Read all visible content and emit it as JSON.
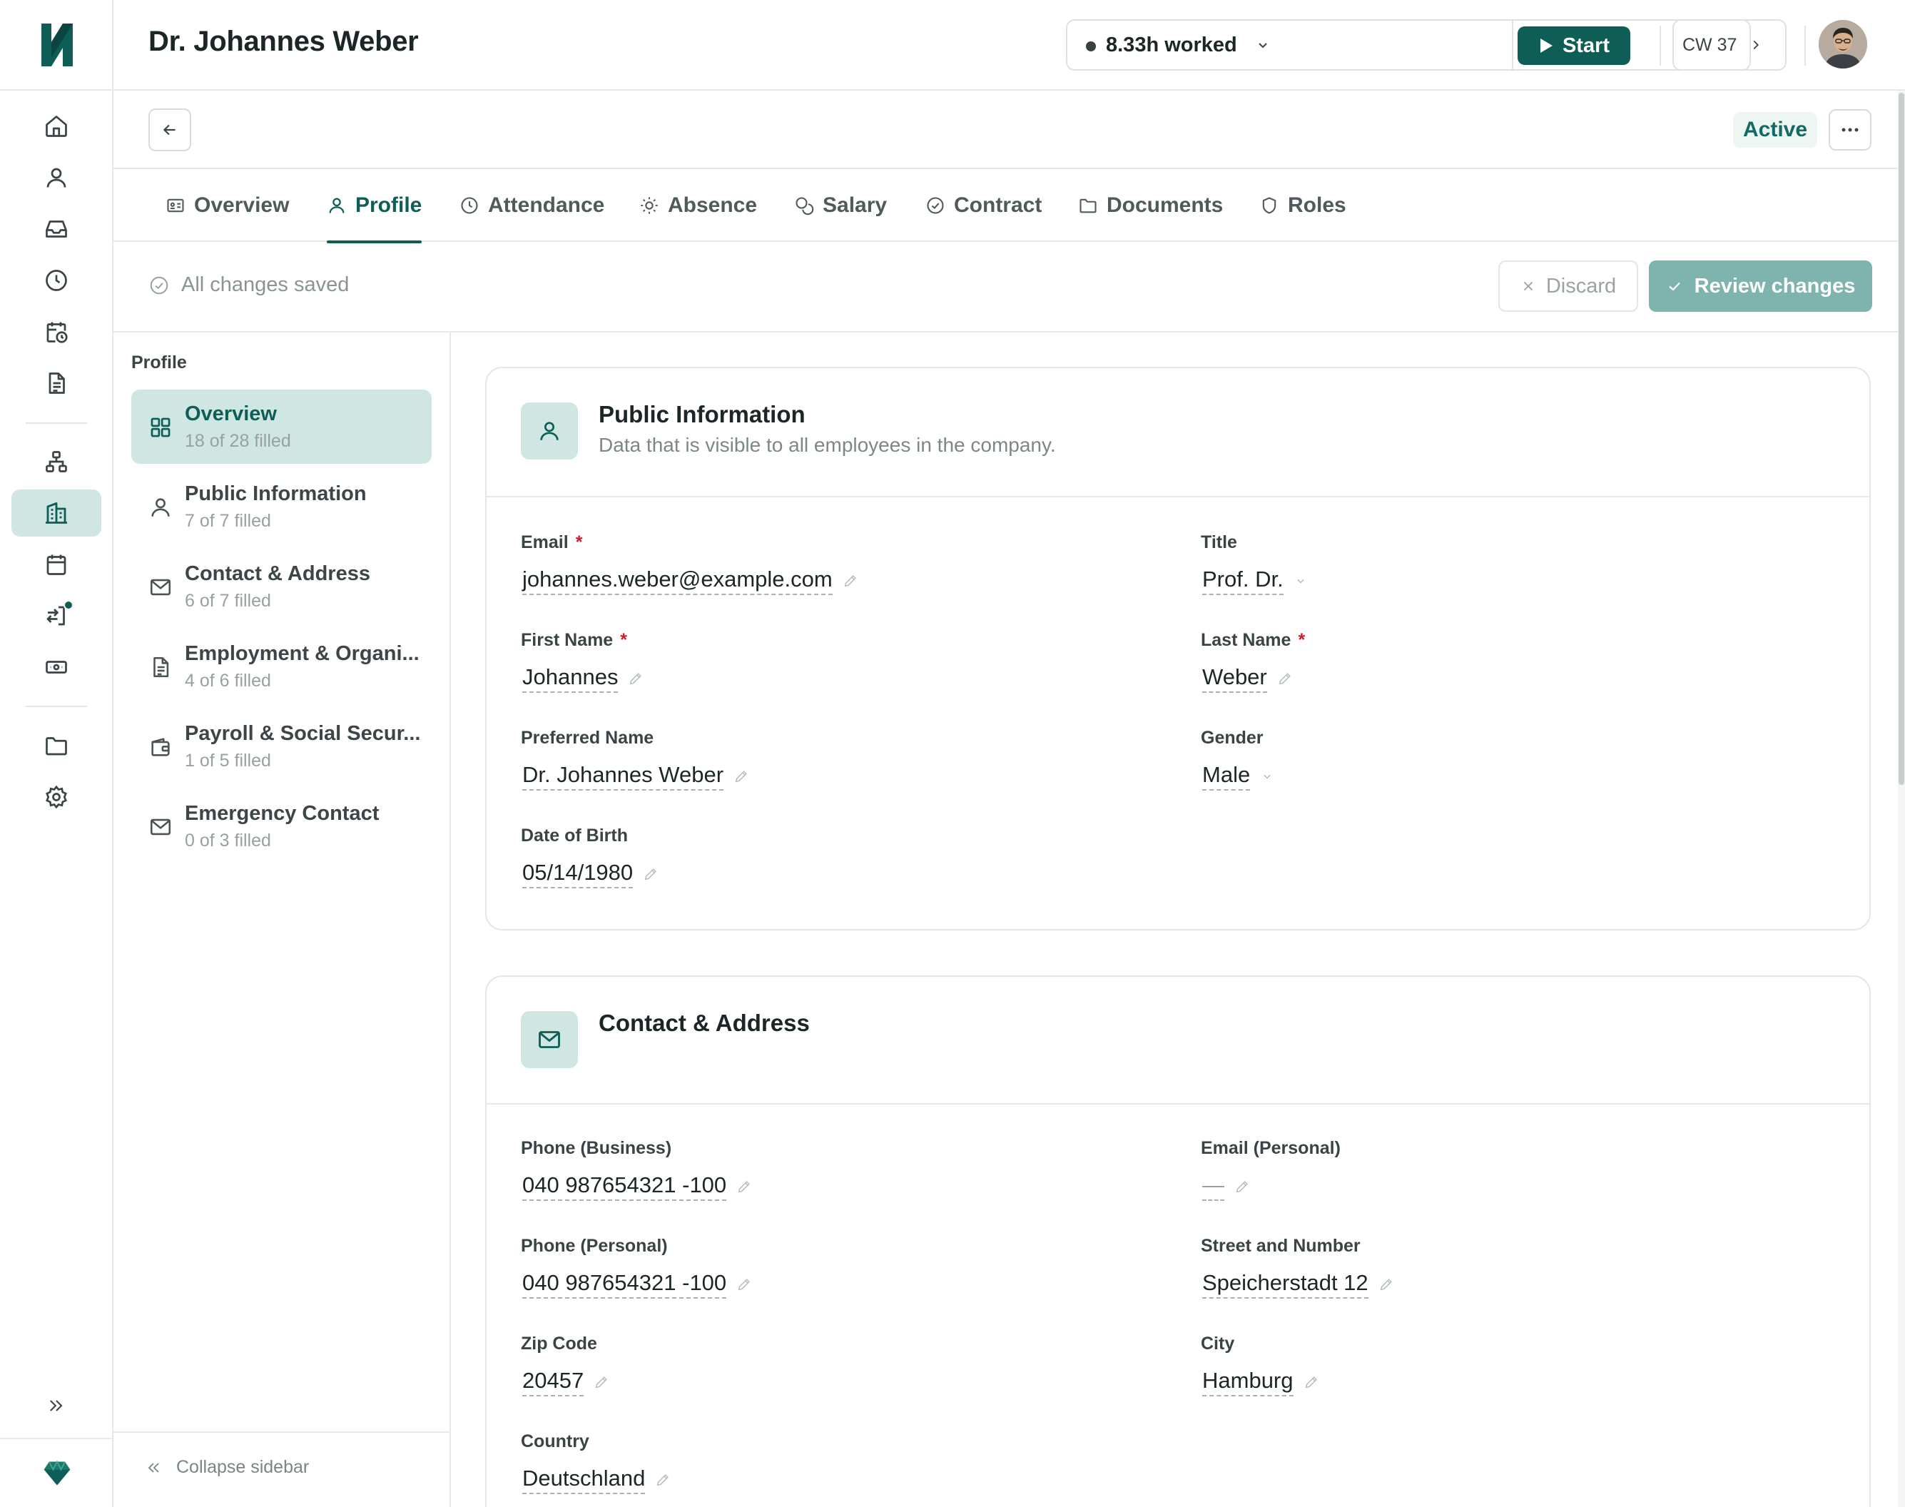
{
  "header": {
    "title": "Dr. Johannes Weber",
    "worked": "8.33h worked",
    "start_label": "Start",
    "week": "CW 37"
  },
  "subbar": {
    "status": "Active"
  },
  "tabs": [
    {
      "label": "Overview",
      "icon": "id-card-icon"
    },
    {
      "label": "Profile",
      "icon": "user-icon"
    },
    {
      "label": "Attendance",
      "icon": "clock-icon"
    },
    {
      "label": "Absence",
      "icon": "sun-icon"
    },
    {
      "label": "Salary",
      "icon": "coins-icon"
    },
    {
      "label": "Contract",
      "icon": "badge-check-icon"
    },
    {
      "label": "Documents",
      "icon": "folder-icon"
    },
    {
      "label": "Roles",
      "icon": "shield-icon"
    }
  ],
  "active_tab": "Profile",
  "savebar": {
    "status": "All changes saved",
    "discard_label": "Discard",
    "review_label": "Review changes"
  },
  "section_nav": {
    "heading": "Profile",
    "items": [
      {
        "label": "Overview",
        "sub": "18 of 28 filled",
        "icon": "grid-icon"
      },
      {
        "label": "Public Information",
        "sub": "7 of 7 filled",
        "icon": "user-icon"
      },
      {
        "label": "Contact & Address",
        "sub": "6 of 7 filled",
        "icon": "mail-icon"
      },
      {
        "label": "Employment & Organi...",
        "sub": "4 of 6 filled",
        "icon": "document-icon"
      },
      {
        "label": "Payroll & Social Secur...",
        "sub": "1 of 5 filled",
        "icon": "wallet-icon"
      },
      {
        "label": "Emergency Contact",
        "sub": "0 of 3 filled",
        "icon": "mail-icon"
      }
    ],
    "collapse_label": "Collapse sidebar"
  },
  "public_info": {
    "title": "Public Information",
    "subtitle": "Data that is visible to all employees in the company.",
    "fields": {
      "email": {
        "label": "Email",
        "value": "johannes.weber@example.com"
      },
      "title": {
        "label": "Title",
        "value": "Prof. Dr."
      },
      "first_name": {
        "label": "First Name",
        "value": "Johannes"
      },
      "last_name": {
        "label": "Last Name",
        "value": "Weber"
      },
      "preferred_name": {
        "label": "Preferred Name",
        "value": "Dr. Johannes Weber"
      },
      "gender": {
        "label": "Gender",
        "value": "Male"
      },
      "dob": {
        "label": "Date of Birth",
        "value": "05/14/1980"
      }
    }
  },
  "contact": {
    "title": "Contact & Address",
    "fields": {
      "phone_business": {
        "label": "Phone (Business)",
        "value": "040 987654321 -100"
      },
      "email_personal": {
        "label": "Email (Personal)",
        "value": "—"
      },
      "phone_personal": {
        "label": "Phone (Personal)",
        "value": "040 987654321 -100"
      },
      "street": {
        "label": "Street and Number",
        "value": "Speicherstadt 12"
      },
      "zip": {
        "label": "Zip Code",
        "value": "20457"
      },
      "city": {
        "label": "City",
        "value": "Hamburg"
      },
      "country": {
        "label": "Country",
        "value": "Deutschland"
      }
    }
  },
  "colors": {
    "brand": "#0f5d57",
    "accent_bg": "#cfe6e2",
    "required": "#d11a2a"
  }
}
